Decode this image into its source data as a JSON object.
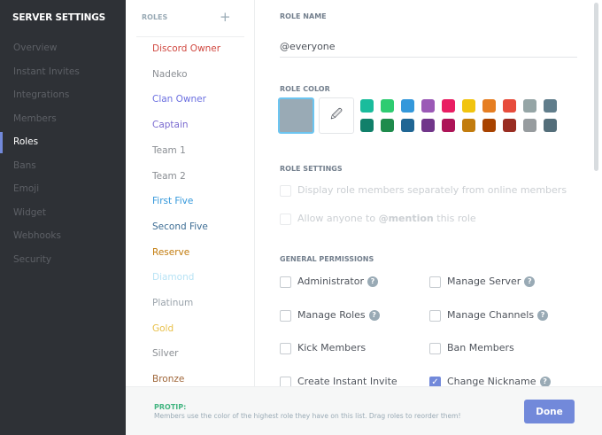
{
  "sidebar": {
    "title": "SERVER SETTINGS",
    "items": [
      "Overview",
      "Instant Invites",
      "Integrations",
      "Members",
      "Roles",
      "Bans",
      "Emoji",
      "Widget",
      "Webhooks",
      "Security"
    ],
    "active": "Roles"
  },
  "roles": {
    "header": "ROLES",
    "add_icon": "+",
    "list": [
      {
        "name": "Discord Owner",
        "color": "#d0473f"
      },
      {
        "name": "Nadeko",
        "color": "#8a8e93"
      },
      {
        "name": "Clan Owner",
        "color": "#6b6fe0"
      },
      {
        "name": "Captain",
        "color": "#7a6ad0"
      },
      {
        "name": "Team 1",
        "color": "#8a8e93"
      },
      {
        "name": "Team 2",
        "color": "#8a8e93"
      },
      {
        "name": "First Five",
        "color": "#3498db"
      },
      {
        "name": "Second Five",
        "color": "#3d6d94"
      },
      {
        "name": "Reserve",
        "color": "#c27c0e"
      },
      {
        "name": "Diamond",
        "color": "#b8e3f5"
      },
      {
        "name": "Platinum",
        "color": "#9aa3ab"
      },
      {
        "name": "Gold",
        "color": "#e8c04a"
      },
      {
        "name": "Silver",
        "color": "#8a8e93"
      },
      {
        "name": "Bronze",
        "color": "#a0673a"
      }
    ]
  },
  "main": {
    "role_name_label": "ROLE NAME",
    "role_name_value": "@everyone",
    "role_color_label": "ROLE COLOR",
    "selected_color": "#99aab5",
    "swatches_top": [
      "#1abc9c",
      "#2ecc71",
      "#3498db",
      "#9b59b6",
      "#e91e63",
      "#f1c40f",
      "#e67e22",
      "#e74c3c",
      "#95a5a6",
      "#607d8b"
    ],
    "swatches_bottom": [
      "#11806a",
      "#1f8b4c",
      "#206694",
      "#71368a",
      "#ad1457",
      "#c27c0e",
      "#a84300",
      "#992d22",
      "#979c9f",
      "#546e7a"
    ],
    "role_settings_label": "ROLE SETTINGS",
    "setting_display": "Display role members separately from online members",
    "setting_mention_pre": "Allow anyone to ",
    "setting_mention_bold": "@mention",
    "setting_mention_post": " this role",
    "general_permissions_label": "GENERAL PERMISSIONS",
    "permissions": [
      {
        "label": "Administrator",
        "help": true,
        "checked": false
      },
      {
        "label": "Manage Server",
        "help": true,
        "checked": false
      },
      {
        "label": "Manage Roles",
        "help": true,
        "checked": false
      },
      {
        "label": "Manage Channels",
        "help": true,
        "checked": false
      },
      {
        "label": "Kick Members",
        "help": false,
        "checked": false
      },
      {
        "label": "Ban Members",
        "help": false,
        "checked": false
      },
      {
        "label": "Create Instant Invite",
        "help": false,
        "checked": false
      },
      {
        "label": "Change Nickname",
        "help": true,
        "checked": true
      }
    ]
  },
  "footer": {
    "protip_label": "PROTIP:",
    "protip_text": "Members use the color of the highest role they have on this list. Drag roles to reorder them!",
    "done_label": "Done"
  }
}
